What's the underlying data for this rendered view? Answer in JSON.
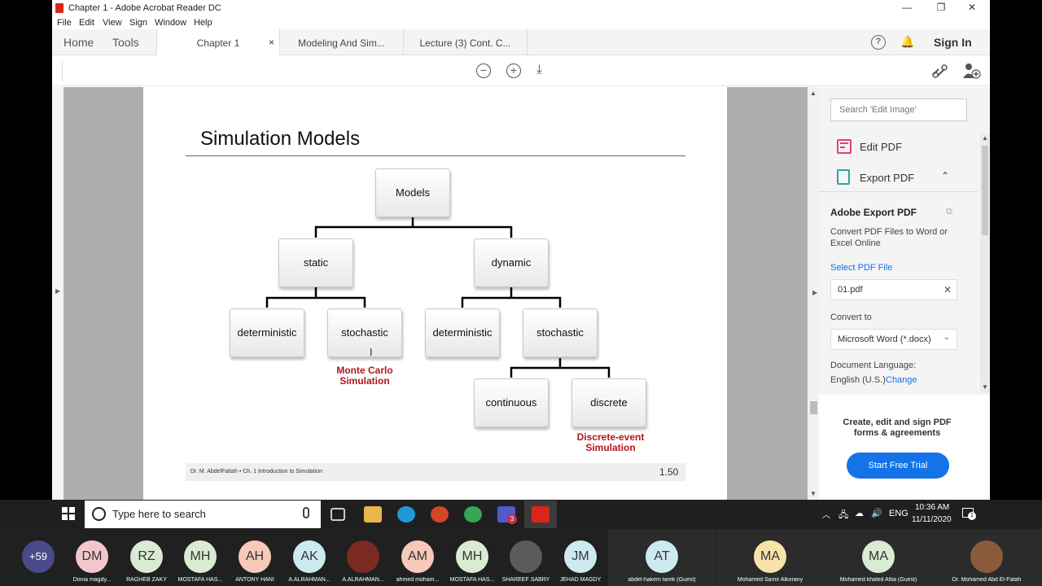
{
  "window": {
    "title": "Chapter 1 - Adobe Acrobat Reader DC",
    "min_label": "—",
    "restore_label": "❐",
    "close_label": "✕"
  },
  "menu": [
    "File",
    "Edit",
    "View",
    "Sign",
    "Window",
    "Help"
  ],
  "nav": {
    "home": "Home",
    "tools": "Tools"
  },
  "tabs": [
    {
      "label": "Chapter 1",
      "close": "×"
    },
    {
      "label": "Modeling And Sim..."
    },
    {
      "label": "Lecture (3) Cont. C..."
    }
  ],
  "header_right": {
    "help_icon": "help-icon",
    "bell_icon": "bell-icon",
    "sign_in": "Sign In"
  },
  "toolbar": {
    "zoom_out": "−",
    "zoom_in": "+",
    "fit": "⤓"
  },
  "slide": {
    "title": "Simulation Models",
    "nodes": {
      "root": "Models",
      "static": "static",
      "dynamic": "dynamic",
      "det1": "deterministic",
      "sto1": "stochastic",
      "det2": "deterministic",
      "sto2": "stochastic",
      "cont": "continuous",
      "disc": "discrete"
    },
    "monte_carlo_1": "Monte Carlo",
    "monte_carlo_2": "Simulation",
    "discrete_event_1": "Discrete-event",
    "discrete_event_2": "Simulation",
    "footer_left": "Dr. M. AbdelFattah • Ch. 1 Introduction to Simulation",
    "page_number": "1.50"
  },
  "right_panel": {
    "search_placeholder": "Search 'Edit Image'",
    "edit_pdf": "Edit PDF",
    "export_pdf": "Export PDF",
    "section_title": "Adobe Export PDF",
    "description": "Convert PDF Files to Word or Excel Online",
    "select_file": "Select PDF File",
    "file_name": "01.pdf",
    "convert_to": "Convert to",
    "format": "Microsoft Word (*.docx)",
    "doc_lang_label": "Document Language:",
    "doc_lang": "English (U.S.)",
    "change": "Change",
    "promo": "Create, edit and sign PDF forms & agreements",
    "trial_button": "Start Free Trial"
  },
  "taskbar": {
    "search_placeholder": "Type here to search",
    "lang": "ENG",
    "time": "10:36 AM",
    "date": "11/11/2020",
    "teams_badge": "3",
    "notif_badge": "1"
  },
  "meeting": {
    "more_count": "+59",
    "participants": [
      {
        "initials": "DM",
        "name": "Donia magdy...",
        "color": "#f2c7cc"
      },
      {
        "initials": "RZ",
        "name": "RAGHEB ZAKY",
        "color": "#d9ecd3"
      },
      {
        "initials": "MH",
        "name": "MOSTAFA HAS...",
        "color": "#d9ecd3"
      },
      {
        "initials": "AH",
        "name": "ANTONY HANI",
        "color": "#f6c9b8"
      },
      {
        "initials": "AK",
        "name": "A.ALRAHMAN...",
        "color": "#cdeaf0"
      },
      {
        "initials": "",
        "name": "A.ALRAHMAN...",
        "color": "#7a2a20"
      },
      {
        "initials": "AM",
        "name": "ahmed moham...",
        "color": "#f6c9b8"
      },
      {
        "initials": "MH",
        "name": "MOSTAFA HAS...",
        "color": "#d9ecd3"
      },
      {
        "initials": "",
        "name": "SHAREEF SABRY",
        "color": "#5b5b5b"
      },
      {
        "initials": "JM",
        "name": "JEHAD MAGDY",
        "color": "#cdeaf0"
      },
      {
        "initials": "AT",
        "name": "abdel-hakem tarek (Guest)",
        "color": "#cdeaf0"
      },
      {
        "initials": "MA",
        "name": "Mohamed Samir Alkorany",
        "color": "#f7e3a8"
      },
      {
        "initials": "MA",
        "name": "Mohamed khaled Attia (Guest)",
        "color": "#d9ecd3"
      },
      {
        "initials": "",
        "name": "Dr. Mohamed Abd El-Fatah",
        "color": "#8a5a3a"
      }
    ]
  }
}
